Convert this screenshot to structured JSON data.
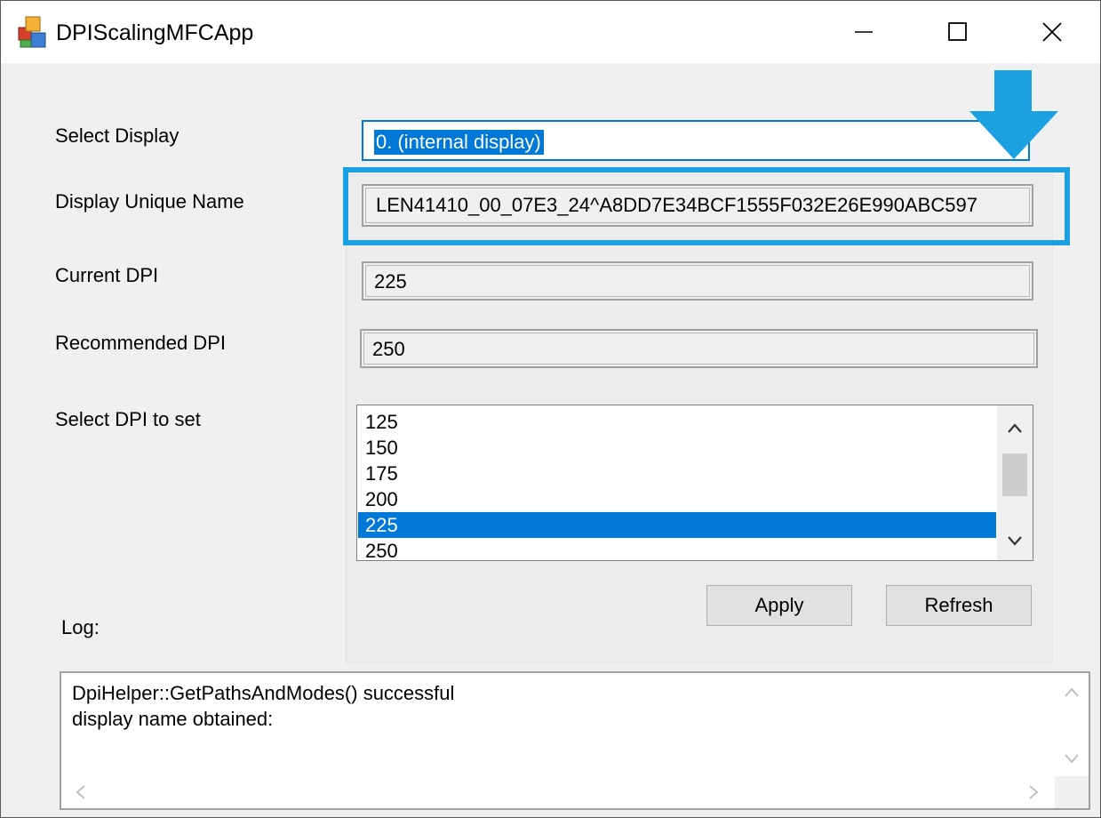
{
  "window": {
    "title": "DPIScalingMFCApp"
  },
  "labels": {
    "select_display": "Select Display",
    "display_unique_name": "Display Unique Name",
    "current_dpi": "Current DPI",
    "recommended_dpi": "Recommended DPI",
    "select_dpi_to_set": "Select DPI to set",
    "log": "Log:"
  },
  "fields": {
    "select_display_value": "0. (internal display)",
    "display_unique_name_value": "LEN41410_00_07E3_24^A8DD7E34BCF1555F032E26E990ABC597",
    "current_dpi_value": "225",
    "recommended_dpi_value": "250"
  },
  "dpi_list": {
    "items": [
      "125",
      "150",
      "175",
      "200",
      "225",
      "250"
    ],
    "selected": "225"
  },
  "buttons": {
    "apply": "Apply",
    "refresh": "Refresh"
  },
  "log": {
    "lines": [
      "DpiHelper::GetPathsAndModes() successful",
      "display name obtained:"
    ]
  },
  "icons": {
    "app": "mfc-app-icon",
    "minimize": "minimize-icon",
    "maximize": "maximize-icon",
    "close": "close-icon",
    "annotation_arrow": "down-arrow-icon"
  },
  "colors": {
    "selection": "#0078d7",
    "annotation": "#1ba1e2"
  }
}
